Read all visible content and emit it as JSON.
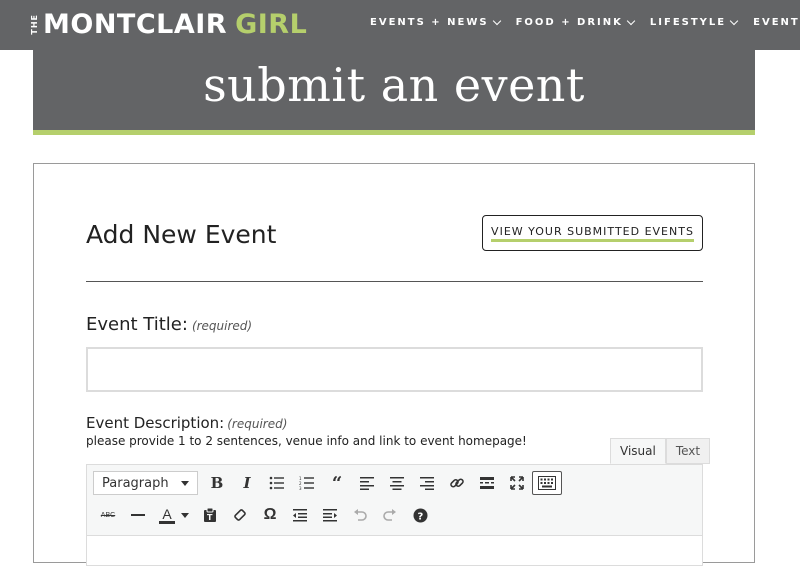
{
  "site": {
    "logo_prefix": "THE",
    "logo_main": "MONTCLAIR",
    "logo_accent": "GIRL",
    "accent_color": "#b5cf6c",
    "header_bg": "#636466"
  },
  "nav": [
    {
      "label": "EVENTS + NEWS"
    },
    {
      "label": "FOOD + DRINK"
    },
    {
      "label": "LIFESTYLE"
    },
    {
      "label": "EVENTS"
    }
  ],
  "hero": {
    "title": "submit an event"
  },
  "form": {
    "heading": "Add New Event",
    "view_button": "VIEW YOUR SUBMITTED EVENTS",
    "event_title_label": "Event Title:",
    "required_text": "(required)",
    "event_title_value": "",
    "description_label": "Event Description:",
    "description_hint": "please provide 1 to 2 sentences, venue info and link to event homepage!",
    "tabs": [
      {
        "label": "Visual"
      },
      {
        "label": "Text"
      }
    ],
    "format_select": "Paragraph",
    "toolbar_row1": [
      "bold-icon",
      "italic-icon",
      "bullet-list-icon",
      "numbered-list-icon",
      "blockquote-icon",
      "align-left-icon",
      "align-center-icon",
      "align-right-icon",
      "link-icon",
      "read-more-icon",
      "fullscreen-icon",
      "toolbar-toggle-icon"
    ],
    "toolbar_row2": [
      "strikethrough-icon",
      "horizontal-line-icon",
      "text-color-icon",
      "paste-text-icon",
      "clear-formatting-icon",
      "special-character-icon",
      "outdent-icon",
      "indent-icon",
      "undo-icon",
      "redo-icon",
      "help-icon"
    ]
  }
}
